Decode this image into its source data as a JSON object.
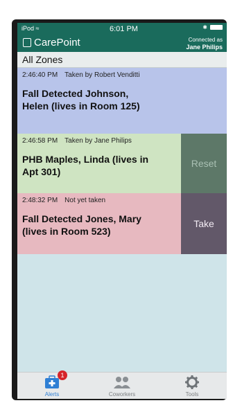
{
  "status_bar": {
    "carrier": "iPod",
    "time": "6:01 PM"
  },
  "header": {
    "app_name": "CarePoint",
    "connected_label": "Connected as",
    "connected_user": "Jane Philips"
  },
  "zone_filter": "All Zones",
  "alerts": [
    {
      "time": "2:46:40 PM",
      "status": "Taken by Robert Venditti",
      "title_line1": "Fall Detected Johnson,",
      "title_line2": "Helen  (lives in Room 125)",
      "action": ""
    },
    {
      "time": "2:46:58 PM",
      "status": "Taken by Jane Philips",
      "title_line1": "PHB Maples, Linda  (lives in",
      "title_line2": "Apt 301)",
      "action": "Reset"
    },
    {
      "time": "2:48:32 PM",
      "status": "Not yet taken",
      "title_line1": "Fall Detected Jones, Mary",
      "title_line2": "(lives in Room 523)",
      "action": "Take"
    }
  ],
  "tabs": [
    {
      "label": "Alerts",
      "icon": "medical-kit-icon",
      "badge": "1",
      "active": true
    },
    {
      "label": "Coworkers",
      "icon": "people-icon",
      "active": false
    },
    {
      "label": "Tools",
      "icon": "gear-icon",
      "active": false
    }
  ],
  "colors": {
    "header": "#1a6b5c",
    "alert_taken_other": "#b8c4ea",
    "alert_taken_me": "#cfe4c2",
    "alert_untaken": "#e7b9c0",
    "active_tab": "#2f7fd4",
    "badge": "#d6242a"
  }
}
